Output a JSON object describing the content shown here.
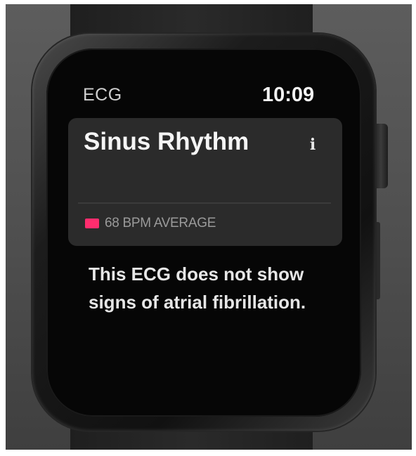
{
  "status": {
    "app_title": "ECG",
    "time": "10:09"
  },
  "result": {
    "title": "Sinus Rhythm",
    "info_icon": "info-icon",
    "bpm_label": "68 BPM AVERAGE",
    "badge_color": "#ff2d6e"
  },
  "description": "This ECG does not show signs of atrial fibrillation."
}
